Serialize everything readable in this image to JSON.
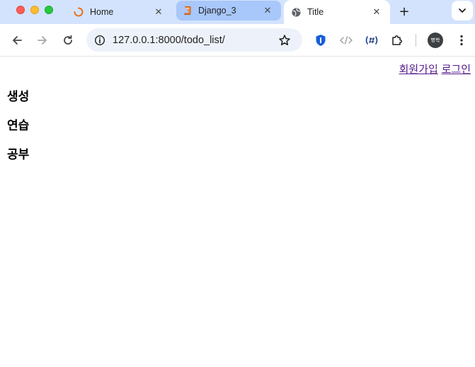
{
  "browser": {
    "tabs": [
      {
        "title": "Home",
        "icon": "loading-spinner-icon",
        "close": "✕"
      },
      {
        "title": "Django_3",
        "icon": "book-icon",
        "close": "✕"
      },
      {
        "title": "Title",
        "icon": "globe-icon",
        "close": "✕"
      }
    ],
    "active_tab": 2,
    "new_tab": "+",
    "address": "127.0.0.1:8000/todo_list/",
    "profile_label": "병학"
  },
  "page": {
    "nav": {
      "signup": "회원가입",
      "login": "로그인"
    },
    "todos": [
      "생성",
      "연습",
      "공부"
    ]
  },
  "colors": {
    "tab_strip": "#d3e3fd",
    "selected_tab_bg": "#a8c7fa",
    "link_visited": "#551a8b"
  }
}
